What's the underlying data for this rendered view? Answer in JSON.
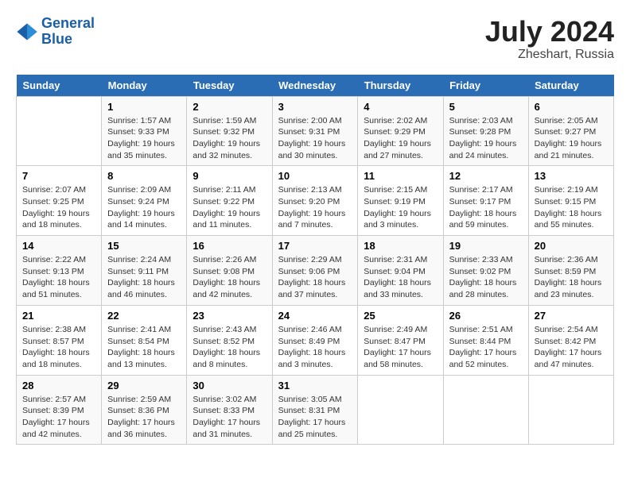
{
  "logo": {
    "text_general": "General",
    "text_blue": "Blue"
  },
  "title": {
    "month_year": "July 2024",
    "location": "Zheshart, Russia"
  },
  "days_of_week": [
    "Sunday",
    "Monday",
    "Tuesday",
    "Wednesday",
    "Thursday",
    "Friday",
    "Saturday"
  ],
  "weeks": [
    [
      {
        "day": "",
        "sunrise": "",
        "sunset": "",
        "daylight": ""
      },
      {
        "day": "1",
        "sunrise": "Sunrise: 1:57 AM",
        "sunset": "Sunset: 9:33 PM",
        "daylight": "Daylight: 19 hours and 35 minutes."
      },
      {
        "day": "2",
        "sunrise": "Sunrise: 1:59 AM",
        "sunset": "Sunset: 9:32 PM",
        "daylight": "Daylight: 19 hours and 32 minutes."
      },
      {
        "day": "3",
        "sunrise": "Sunrise: 2:00 AM",
        "sunset": "Sunset: 9:31 PM",
        "daylight": "Daylight: 19 hours and 30 minutes."
      },
      {
        "day": "4",
        "sunrise": "Sunrise: 2:02 AM",
        "sunset": "Sunset: 9:29 PM",
        "daylight": "Daylight: 19 hours and 27 minutes."
      },
      {
        "day": "5",
        "sunrise": "Sunrise: 2:03 AM",
        "sunset": "Sunset: 9:28 PM",
        "daylight": "Daylight: 19 hours and 24 minutes."
      },
      {
        "day": "6",
        "sunrise": "Sunrise: 2:05 AM",
        "sunset": "Sunset: 9:27 PM",
        "daylight": "Daylight: 19 hours and 21 minutes."
      }
    ],
    [
      {
        "day": "7",
        "sunrise": "Sunrise: 2:07 AM",
        "sunset": "Sunset: 9:25 PM",
        "daylight": "Daylight: 19 hours and 18 minutes."
      },
      {
        "day": "8",
        "sunrise": "Sunrise: 2:09 AM",
        "sunset": "Sunset: 9:24 PM",
        "daylight": "Daylight: 19 hours and 14 minutes."
      },
      {
        "day": "9",
        "sunrise": "Sunrise: 2:11 AM",
        "sunset": "Sunset: 9:22 PM",
        "daylight": "Daylight: 19 hours and 11 minutes."
      },
      {
        "day": "10",
        "sunrise": "Sunrise: 2:13 AM",
        "sunset": "Sunset: 9:20 PM",
        "daylight": "Daylight: 19 hours and 7 minutes."
      },
      {
        "day": "11",
        "sunrise": "Sunrise: 2:15 AM",
        "sunset": "Sunset: 9:19 PM",
        "daylight": "Daylight: 19 hours and 3 minutes."
      },
      {
        "day": "12",
        "sunrise": "Sunrise: 2:17 AM",
        "sunset": "Sunset: 9:17 PM",
        "daylight": "Daylight: 18 hours and 59 minutes."
      },
      {
        "day": "13",
        "sunrise": "Sunrise: 2:19 AM",
        "sunset": "Sunset: 9:15 PM",
        "daylight": "Daylight: 18 hours and 55 minutes."
      }
    ],
    [
      {
        "day": "14",
        "sunrise": "Sunrise: 2:22 AM",
        "sunset": "Sunset: 9:13 PM",
        "daylight": "Daylight: 18 hours and 51 minutes."
      },
      {
        "day": "15",
        "sunrise": "Sunrise: 2:24 AM",
        "sunset": "Sunset: 9:11 PM",
        "daylight": "Daylight: 18 hours and 46 minutes."
      },
      {
        "day": "16",
        "sunrise": "Sunrise: 2:26 AM",
        "sunset": "Sunset: 9:08 PM",
        "daylight": "Daylight: 18 hours and 42 minutes."
      },
      {
        "day": "17",
        "sunrise": "Sunrise: 2:29 AM",
        "sunset": "Sunset: 9:06 PM",
        "daylight": "Daylight: 18 hours and 37 minutes."
      },
      {
        "day": "18",
        "sunrise": "Sunrise: 2:31 AM",
        "sunset": "Sunset: 9:04 PM",
        "daylight": "Daylight: 18 hours and 33 minutes."
      },
      {
        "day": "19",
        "sunrise": "Sunrise: 2:33 AM",
        "sunset": "Sunset: 9:02 PM",
        "daylight": "Daylight: 18 hours and 28 minutes."
      },
      {
        "day": "20",
        "sunrise": "Sunrise: 2:36 AM",
        "sunset": "Sunset: 8:59 PM",
        "daylight": "Daylight: 18 hours and 23 minutes."
      }
    ],
    [
      {
        "day": "21",
        "sunrise": "Sunrise: 2:38 AM",
        "sunset": "Sunset: 8:57 PM",
        "daylight": "Daylight: 18 hours and 18 minutes."
      },
      {
        "day": "22",
        "sunrise": "Sunrise: 2:41 AM",
        "sunset": "Sunset: 8:54 PM",
        "daylight": "Daylight: 18 hours and 13 minutes."
      },
      {
        "day": "23",
        "sunrise": "Sunrise: 2:43 AM",
        "sunset": "Sunset: 8:52 PM",
        "daylight": "Daylight: 18 hours and 8 minutes."
      },
      {
        "day": "24",
        "sunrise": "Sunrise: 2:46 AM",
        "sunset": "Sunset: 8:49 PM",
        "daylight": "Daylight: 18 hours and 3 minutes."
      },
      {
        "day": "25",
        "sunrise": "Sunrise: 2:49 AM",
        "sunset": "Sunset: 8:47 PM",
        "daylight": "Daylight: 17 hours and 58 minutes."
      },
      {
        "day": "26",
        "sunrise": "Sunrise: 2:51 AM",
        "sunset": "Sunset: 8:44 PM",
        "daylight": "Daylight: 17 hours and 52 minutes."
      },
      {
        "day": "27",
        "sunrise": "Sunrise: 2:54 AM",
        "sunset": "Sunset: 8:42 PM",
        "daylight": "Daylight: 17 hours and 47 minutes."
      }
    ],
    [
      {
        "day": "28",
        "sunrise": "Sunrise: 2:57 AM",
        "sunset": "Sunset: 8:39 PM",
        "daylight": "Daylight: 17 hours and 42 minutes."
      },
      {
        "day": "29",
        "sunrise": "Sunrise: 2:59 AM",
        "sunset": "Sunset: 8:36 PM",
        "daylight": "Daylight: 17 hours and 36 minutes."
      },
      {
        "day": "30",
        "sunrise": "Sunrise: 3:02 AM",
        "sunset": "Sunset: 8:33 PM",
        "daylight": "Daylight: 17 hours and 31 minutes."
      },
      {
        "day": "31",
        "sunrise": "Sunrise: 3:05 AM",
        "sunset": "Sunset: 8:31 PM",
        "daylight": "Daylight: 17 hours and 25 minutes."
      },
      {
        "day": "",
        "sunrise": "",
        "sunset": "",
        "daylight": ""
      },
      {
        "day": "",
        "sunrise": "",
        "sunset": "",
        "daylight": ""
      },
      {
        "day": "",
        "sunrise": "",
        "sunset": "",
        "daylight": ""
      }
    ]
  ]
}
